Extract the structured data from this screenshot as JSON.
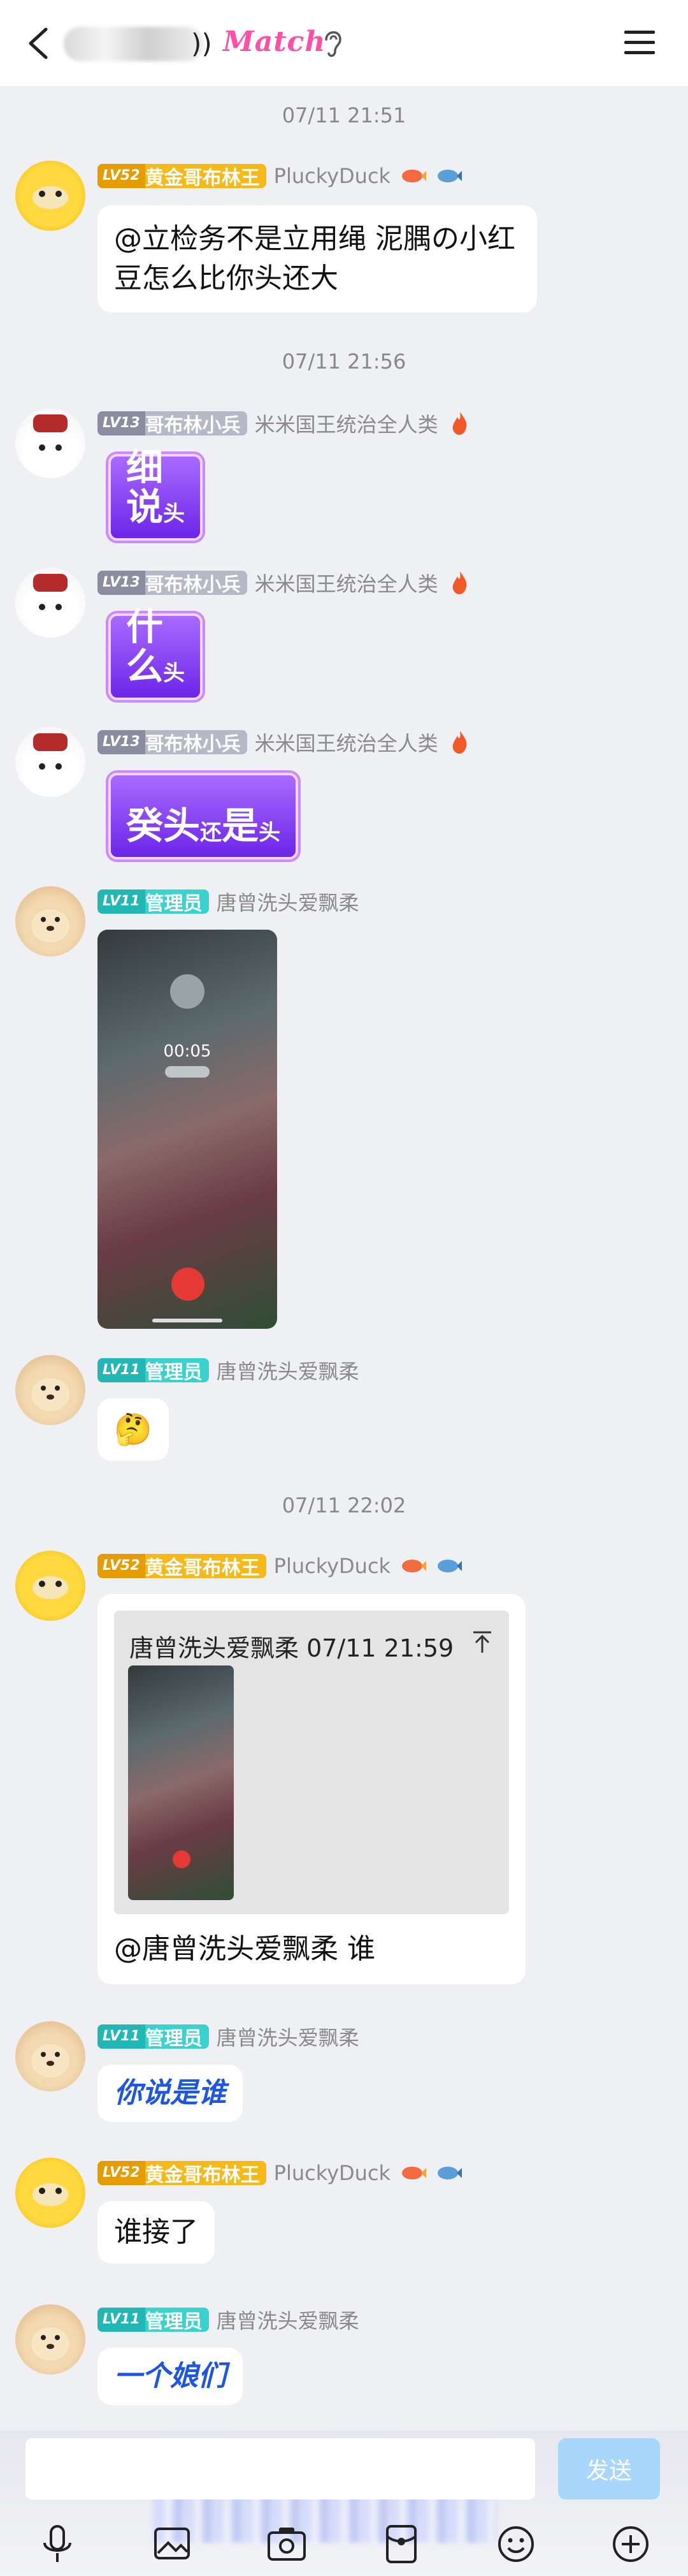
{
  "header": {
    "title_suffix": "))",
    "match_label": "Match"
  },
  "colors": {
    "accent": "#1d56e0",
    "send_bg": "#a9d7fb",
    "gold": "#f6b918",
    "teal": "#39d2cc"
  },
  "messages": [
    {
      "type": "time",
      "text": "07/11 21:51"
    },
    {
      "type": "text",
      "avatar": "duck",
      "level": "LV52",
      "title": "黄金哥布林王",
      "nick": "PluckyDuck",
      "text_line1": "@立检务不是立用绳 泥腢の小红",
      "text_line2": "豆怎么比你头还大"
    },
    {
      "type": "time",
      "text": "07/11 21:56"
    },
    {
      "type": "sticker",
      "avatar": "soldier",
      "level": "LV13",
      "title": "哥布林小兵",
      "nick": "米米国王统治全人类",
      "big": "细说",
      "small": "头"
    },
    {
      "type": "sticker",
      "avatar": "soldier",
      "level": "LV13",
      "title": "哥布林小兵",
      "nick": "米米国王统治全人类",
      "big": "什么",
      "small": "头"
    },
    {
      "type": "sticker",
      "avatar": "soldier",
      "level": "LV13",
      "title": "哥布林小兵",
      "nick": "米米国王统治全人类",
      "parts": [
        "癸",
        "头",
        "还",
        "是",
        "头"
      ]
    },
    {
      "type": "image",
      "avatar": "dog",
      "level": "LV11",
      "title": "管理员",
      "nick": "唐曾洗头爱飘柔",
      "call_time": "00:05"
    },
    {
      "type": "emoji",
      "avatar": "dog",
      "level": "LV11",
      "title": "管理员",
      "nick": "唐曾洗头爱飘柔",
      "emoji": "🤔"
    },
    {
      "type": "time",
      "text": "07/11 22:02"
    },
    {
      "type": "quote",
      "avatar": "duck",
      "level": "LV52",
      "title": "黄金哥布林王",
      "nick": "PluckyDuck",
      "quote_header": "唐曾洗头爱飘柔 07/11 21:59",
      "text": "@唐曾洗头爱飘柔 谁"
    },
    {
      "type": "text",
      "avatar": "dog",
      "level": "LV11",
      "title": "管理员",
      "nick": "唐曾洗头爱飘柔",
      "text": "你说是谁"
    },
    {
      "type": "text",
      "avatar": "duck",
      "level": "LV52",
      "title": "黄金哥布林王",
      "nick": "PluckyDuck",
      "text": "谁接了"
    },
    {
      "type": "text",
      "avatar": "dog",
      "level": "LV11",
      "title": "管理员",
      "nick": "唐曾洗头爱飘柔",
      "text": "一个娘们"
    }
  ],
  "input": {
    "value": "",
    "send_label": "发送"
  },
  "toolbar_icons": [
    "microphone-icon",
    "image-icon",
    "camera-icon",
    "red-packet-icon",
    "emoji-icon",
    "plus-icon"
  ]
}
